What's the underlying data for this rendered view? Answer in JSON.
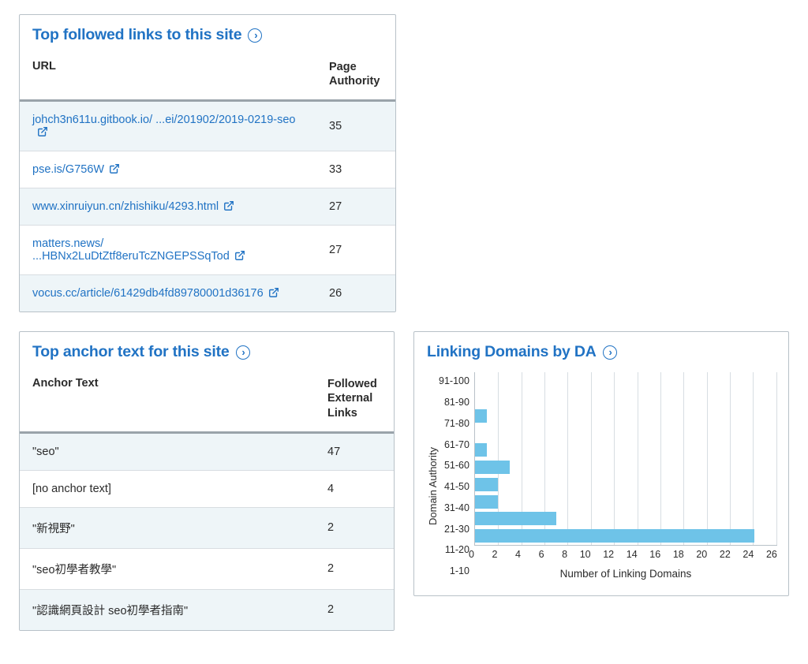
{
  "followed_links": {
    "title": "Top followed links to this site",
    "col_url": "URL",
    "col_val": "Page Authority",
    "rows": [
      {
        "url": "johch3n611u.gitbook.io/ ...ei/201902/2019-0219-seo",
        "val": "35"
      },
      {
        "url": "pse.is/G756W",
        "val": "33"
      },
      {
        "url": "www.xinruiyun.cn/zhishiku/4293.html",
        "val": "27"
      },
      {
        "url": "matters.news/ ...HBNx2LuDtZtf8eruTcZNGEPSSqTod",
        "val": "27"
      },
      {
        "url": "vocus.cc/article/61429db4fd89780001d36176",
        "val": "26"
      }
    ]
  },
  "anchor_text": {
    "title": "Top anchor text for this site",
    "col_text": "Anchor Text",
    "col_val": "Followed External Links",
    "rows": [
      {
        "text": "\"seo\"",
        "val": "47"
      },
      {
        "text": "[no anchor text]",
        "val": "4"
      },
      {
        "text": "\"新視野\"",
        "val": "2"
      },
      {
        "text": "\"seo初學者教學\"",
        "val": "2"
      },
      {
        "text": "\"認識網頁設計 seo初學者指南\"",
        "val": "2"
      }
    ]
  },
  "linking_domains": {
    "title": "Linking Domains by DA",
    "y_label": "Domain Authority",
    "x_label": "Number of Linking Domains"
  },
  "chart_data": {
    "type": "bar",
    "orientation": "horizontal",
    "title": "Linking Domains by DA",
    "ylabel": "Domain Authority",
    "xlabel": "Number of Linking Domains",
    "categories": [
      "91-100",
      "81-90",
      "71-80",
      "61-70",
      "51-60",
      "41-50",
      "31-40",
      "21-30",
      "11-20",
      "1-10"
    ],
    "values": [
      0,
      0,
      1,
      0,
      1,
      3,
      2,
      2,
      7,
      24
    ],
    "xlim": [
      0,
      26
    ],
    "x_ticks": [
      0,
      2,
      4,
      6,
      8,
      10,
      12,
      14,
      16,
      18,
      20,
      22,
      24,
      26
    ]
  }
}
